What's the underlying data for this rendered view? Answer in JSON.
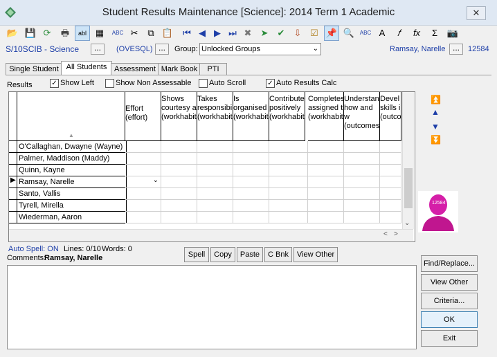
{
  "window": {
    "title": "Student Results Maintenance  [Science]:  2014 Term 1 Academic",
    "close_label": "✕"
  },
  "selector": {
    "class_code": "S/10SCIB - Science",
    "ovesql": "(OVESQL)",
    "group_label": "Group:",
    "group_value": "Unlocked Groups",
    "teacher": "Ramsay, Narelle",
    "teacher_id": "12584",
    "dots": "..."
  },
  "tabs": [
    "Single Student",
    "All Students",
    "Assessment",
    "Mark Book",
    "PTI"
  ],
  "options": {
    "results_label": "Results",
    "show_left": "Show Left",
    "show_non_assessable": "Show Non Assessable",
    "auto_scroll": "Auto Scroll",
    "auto_results_calc": "Auto Results Calc"
  },
  "grid": {
    "columns": [
      "Effort (effort)",
      "Shows courtesy a (workhabit",
      "Takes responsibi (workhabit",
      "Is organised (workhabit",
      "Contribute positively (workhabit",
      "Completes assigned t (workhabit",
      "Understan how and w (outcomes",
      "Devel skills i (outco"
    ],
    "students": [
      "O'Callaghan, Dwayne (Wayne)",
      "Palmer, Maddison (Maddy)",
      "Quinn, Kayne",
      "Ramsay, Narelle",
      "Santo, Vallis",
      "Tyrell, Mirella",
      "Wiederman, Aaron"
    ]
  },
  "status": {
    "auto_spell": "Auto Spell: ON",
    "lines": "Lines: 0/10",
    "words": "Words:  0",
    "comments_label": "Comments:",
    "comments_student": "Ramsay, Narelle"
  },
  "buttons": {
    "spell": "Spell",
    "copy": "Copy",
    "paste": "Paste",
    "cbnk": "C Bnk",
    "view_other": "View Other"
  },
  "side_buttons": {
    "find_replace": "Find/Replace...",
    "view_other": "View Other",
    "criteria": "Criteria...",
    "ok": "OK",
    "exit": "Exit"
  },
  "photo_badge": "12584"
}
